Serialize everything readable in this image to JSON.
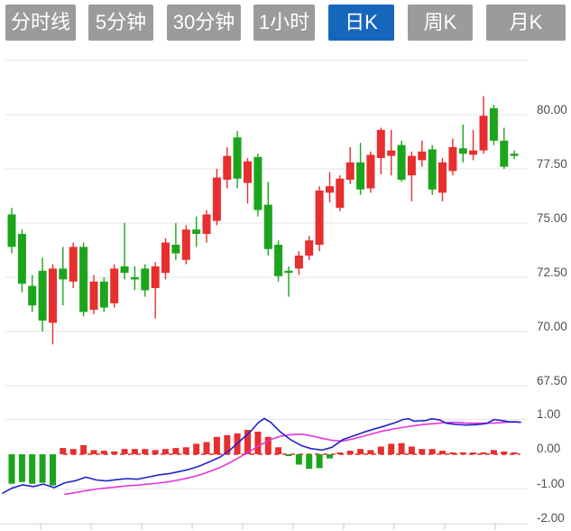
{
  "tabs": [
    {
      "label": "分时线",
      "active": false
    },
    {
      "label": "5分钟",
      "active": false
    },
    {
      "label": "30分钟",
      "active": false
    },
    {
      "label": "1小时",
      "active": false
    },
    {
      "label": "日K",
      "active": true
    },
    {
      "label": "周K",
      "active": false
    },
    {
      "label": "月K",
      "active": false
    }
  ],
  "price_axis_labels": [
    "80.00",
    "77.50",
    "75.00",
    "72.50",
    "70.00",
    "67.50"
  ],
  "macd_axis_labels": [
    "1.00",
    "0.00",
    "-1.00",
    "-2.00"
  ],
  "colors": {
    "up": "#e62f2e",
    "down": "#1ca51c",
    "dif_line": "#2222cc",
    "dea_line": "#e435dc",
    "grid": "#e5e5e5",
    "axis_line": "#d4d4d4",
    "tick": "#c3c3c3",
    "axis_text": "#4f4f4f",
    "tab_bg": "#9b9b9b",
    "tab_active_bg": "#1766be",
    "tab_text": "#ffffff"
  },
  "chart_data": {
    "type": "candlestick",
    "description": "Daily K-line chart with MACD sub-panel, red = up / green = down",
    "main_panel": {
      "ylim": [
        67.0,
        82.5
      ],
      "grid": true,
      "gridline_values": [
        82.5,
        80.0,
        77.5,
        75.0,
        72.5,
        70.0,
        67.5
      ],
      "candles_ohlc": [
        [
          75.4,
          75.7,
          73.6,
          73.9
        ],
        [
          74.5,
          74.7,
          71.8,
          72.2
        ],
        [
          72.1,
          72.6,
          70.9,
          71.2
        ],
        [
          72.8,
          73.4,
          70.0,
          70.5
        ],
        [
          70.4,
          73.1,
          69.4,
          72.9
        ],
        [
          72.9,
          73.9,
          71.2,
          72.4
        ],
        [
          72.3,
          74.1,
          72.0,
          73.9
        ],
        [
          73.9,
          74.1,
          70.7,
          70.9
        ],
        [
          71.0,
          72.6,
          70.8,
          72.3
        ],
        [
          72.3,
          72.5,
          70.9,
          71.1
        ],
        [
          71.3,
          73.1,
          71.1,
          72.9
        ],
        [
          73.0,
          75.0,
          72.4,
          72.7
        ],
        [
          72.5,
          73.0,
          71.9,
          72.4
        ],
        [
          72.9,
          73.1,
          71.6,
          71.9
        ],
        [
          72.0,
          73.2,
          70.6,
          73.0
        ],
        [
          72.7,
          74.3,
          72.4,
          74.1
        ],
        [
          74.0,
          75.0,
          73.3,
          73.6
        ],
        [
          73.3,
          74.9,
          73.1,
          74.7
        ],
        [
          74.7,
          75.3,
          73.9,
          74.5
        ],
        [
          74.5,
          75.6,
          74.1,
          75.4
        ],
        [
          75.1,
          77.5,
          74.9,
          77.1
        ],
        [
          77.0,
          78.5,
          76.6,
          78.1
        ],
        [
          78.95,
          79.25,
          76.6,
          77.05
        ],
        [
          76.85,
          78.0,
          75.9,
          77.85
        ],
        [
          78.05,
          78.2,
          75.3,
          75.6
        ],
        [
          75.85,
          76.9,
          73.5,
          73.8
        ],
        [
          74.0,
          74.2,
          72.3,
          72.55
        ],
        [
          72.8,
          73.0,
          71.6,
          72.7
        ],
        [
          72.9,
          73.7,
          72.6,
          73.5
        ],
        [
          73.5,
          74.4,
          73.3,
          74.2
        ],
        [
          74.0,
          76.7,
          73.7,
          76.5
        ],
        [
          76.4,
          77.35,
          75.95,
          76.7
        ],
        [
          75.7,
          77.2,
          75.55,
          77.05
        ],
        [
          77.0,
          78.5,
          76.8,
          77.8
        ],
        [
          77.8,
          78.7,
          76.3,
          76.55
        ],
        [
          76.6,
          78.3,
          76.4,
          78.15
        ],
        [
          78.0,
          79.4,
          77.25,
          79.3
        ],
        [
          78.1,
          79.3,
          77.2,
          78.35
        ],
        [
          78.6,
          78.8,
          76.9,
          77.0
        ],
        [
          77.2,
          78.3,
          76.0,
          78.1
        ],
        [
          77.9,
          78.8,
          77.6,
          78.3
        ],
        [
          78.4,
          78.6,
          76.3,
          76.55
        ],
        [
          76.4,
          78.0,
          76.0,
          77.8
        ],
        [
          77.4,
          78.9,
          77.2,
          78.5
        ],
        [
          78.45,
          79.55,
          77.8,
          78.2
        ],
        [
          78.15,
          79.3,
          77.9,
          78.35
        ],
        [
          78.35,
          80.85,
          78.2,
          79.95
        ],
        [
          80.3,
          80.45,
          78.6,
          78.8
        ],
        [
          78.8,
          79.4,
          77.5,
          77.6
        ],
        [
          78.2,
          78.35,
          77.95,
          78.1
        ]
      ]
    },
    "macd_panel": {
      "ylim": [
        -2.2,
        1.3
      ],
      "grid": true,
      "gridline_values": [
        1.0,
        -1.0
      ],
      "zero_line": 0.0,
      "histogram": [
        -0.85,
        -0.8,
        -0.85,
        -0.82,
        -0.9,
        0.18,
        0.15,
        0.26,
        0.12,
        0.1,
        0.08,
        0.15,
        0.15,
        0.15,
        0.12,
        0.15,
        0.18,
        0.2,
        0.3,
        0.35,
        0.5,
        0.55,
        0.6,
        0.7,
        0.65,
        0.5,
        0.2,
        -0.05,
        -0.3,
        -0.42,
        -0.4,
        -0.12,
        0.05,
        0.1,
        0.15,
        0.12,
        0.22,
        0.3,
        0.32,
        0.22,
        0.15,
        0.15,
        0.1,
        0.04,
        0.05,
        0.04,
        0.05,
        0.12,
        0.08,
        0.04
      ],
      "dif": [
        [
          3,
          -1.12
        ],
        [
          13,
          -0.98
        ],
        [
          25,
          -0.88
        ],
        [
          37,
          -0.93
        ],
        [
          48,
          -0.86
        ],
        [
          60,
          -0.96
        ],
        [
          72,
          -0.82
        ],
        [
          84,
          -0.76
        ],
        [
          95,
          -0.66
        ],
        [
          107,
          -0.74
        ],
        [
          118,
          -0.77
        ],
        [
          130,
          -0.73
        ],
        [
          141,
          -0.7
        ],
        [
          152,
          -0.72
        ],
        [
          164,
          -0.66
        ],
        [
          175,
          -0.6
        ],
        [
          187,
          -0.56
        ],
        [
          198,
          -0.5
        ],
        [
          209,
          -0.44
        ],
        [
          221,
          -0.34
        ],
        [
          232,
          -0.22
        ],
        [
          244,
          -0.08
        ],
        [
          255,
          0.12
        ],
        [
          266,
          0.38
        ],
        [
          278,
          0.66
        ],
        [
          286,
          0.9
        ],
        [
          293,
          1.03
        ],
        [
          300,
          0.92
        ],
        [
          311,
          0.64
        ],
        [
          322,
          0.42
        ],
        [
          334,
          0.25
        ],
        [
          345,
          0.16
        ],
        [
          357,
          0.12
        ],
        [
          368,
          0.2
        ],
        [
          380,
          0.42
        ],
        [
          391,
          0.52
        ],
        [
          403,
          0.63
        ],
        [
          414,
          0.72
        ],
        [
          425,
          0.8
        ],
        [
          437,
          0.9
        ],
        [
          447,
          1.0
        ],
        [
          453,
          1.02
        ],
        [
          459,
          0.95
        ],
        [
          466,
          0.96
        ],
        [
          472,
          0.97
        ],
        [
          478,
          1.02
        ],
        [
          487,
          0.99
        ],
        [
          495,
          0.89
        ],
        [
          505,
          0.86
        ],
        [
          516,
          0.84
        ],
        [
          527,
          0.85
        ],
        [
          539,
          0.88
        ],
        [
          548,
          1.0
        ],
        [
          556,
          0.97
        ],
        [
          565,
          0.93
        ],
        [
          572,
          0.93
        ],
        [
          577,
          0.92
        ]
      ],
      "dea": [
        [
          72,
          -1.15
        ],
        [
          84,
          -1.1
        ],
        [
          95,
          -1.05
        ],
        [
          107,
          -1.0
        ],
        [
          118,
          -0.97
        ],
        [
          130,
          -0.94
        ],
        [
          141,
          -0.91
        ],
        [
          152,
          -0.89
        ],
        [
          164,
          -0.86
        ],
        [
          175,
          -0.83
        ],
        [
          187,
          -0.79
        ],
        [
          198,
          -0.74
        ],
        [
          209,
          -0.68
        ],
        [
          221,
          -0.6
        ],
        [
          232,
          -0.5
        ],
        [
          244,
          -0.38
        ],
        [
          255,
          -0.24
        ],
        [
          266,
          -0.08
        ],
        [
          278,
          0.1
        ],
        [
          288,
          0.26
        ],
        [
          300,
          0.42
        ],
        [
          311,
          0.52
        ],
        [
          322,
          0.56
        ],
        [
          334,
          0.58
        ],
        [
          345,
          0.53
        ],
        [
          357,
          0.46
        ],
        [
          368,
          0.4
        ],
        [
          380,
          0.38
        ],
        [
          391,
          0.44
        ],
        [
          403,
          0.52
        ],
        [
          414,
          0.6
        ],
        [
          425,
          0.67
        ],
        [
          437,
          0.73
        ],
        [
          448,
          0.78
        ],
        [
          459,
          0.82
        ],
        [
          470,
          0.86
        ],
        [
          482,
          0.88
        ],
        [
          493,
          0.91
        ],
        [
          505,
          0.92
        ],
        [
          516,
          0.9
        ],
        [
          527,
          0.89
        ],
        [
          539,
          0.89
        ],
        [
          550,
          0.9
        ],
        [
          561,
          0.92
        ],
        [
          570,
          0.93
        ],
        [
          577,
          0.92
        ]
      ]
    },
    "x_axis": {
      "tick_xs": [
        45,
        101,
        157,
        213,
        269,
        325,
        381,
        437,
        493,
        549
      ]
    }
  }
}
